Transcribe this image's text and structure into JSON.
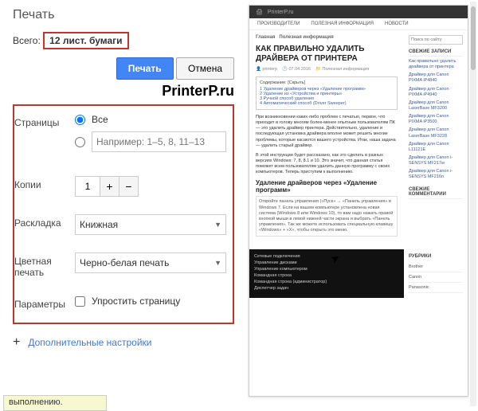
{
  "dialog": {
    "title": "Печать",
    "total_label": "Всего:",
    "total_value": "12 лист. бумаги",
    "print_button": "Печать",
    "cancel_button": "Отмена",
    "logo": "PrinterP.ru"
  },
  "form": {
    "pages_label": "Страницы",
    "pages_all": "Все",
    "pages_example_placeholder": "Например: 1–5, 8, 11–13",
    "copies_label": "Копии",
    "copies_value": "1",
    "layout_label": "Раскладка",
    "layout_value": "Книжная",
    "color_label": "Цветная\nпечать",
    "color_value": "Черно-белая печать",
    "options_label": "Параметры",
    "simplify_label": "Упростить страницу"
  },
  "more_settings": "Дополнительные настройки",
  "bottom_note": "выполнению.",
  "preview": {
    "site_name": "PrinterP.ru",
    "nav": [
      "ПРОИЗВОДИТЕЛИ",
      "ПОЛЕЗНАЯ ИНФОРМАЦИЯ",
      "НОВОСТИ"
    ],
    "breadcrumb": [
      "Главная",
      "Полезная информация"
    ],
    "h1": "КАК ПРАВИЛЬНО УДАЛИТЬ ДРАЙВЕРА ОТ ПРИНТЕРА",
    "author": "printerp",
    "date": "07.04.2016",
    "category": "Полезная информация",
    "toc_title": "Содержание: [Скрыть]",
    "toc": [
      "1 Удаление драйверов через «Удаление программ»",
      "2 Удаление из «Устройства и принтеры»",
      "3 Ручной способ удаления",
      "4 Автоматический способ (Driver Sweeper)"
    ],
    "p1": "При возникновении каких-либо проблем с печатью, первое, что приходит в голову многим более-менее опытным пользователям ПК — это удалить драйвер принтера. Действительно, удаление и последующая установка драйвера вполне может решить многие проблемы, которые касаются вашего устройства. Итак, наша задача — удалить старый драйвер.",
    "p2": "В этой инструкции будет рассказано, как это сделать в разных версиях Windows: 7, 8, 8.1 и 10. Это значит, что данная статья поможет всем пользователям удалить данную программу с своих компьютеров. Теперь приступим к выполнению.",
    "h2": "Удаление драйверов через «Удаление программ»",
    "quote": "Откройте панель управления («Пуск» → «Панель управления» в Windows 7. Если на вашем компьютере установлена новая система (Windows 8 или Windows 10), то вам надо нажать правой кнопкой мыши в левой нижней части экрана и выбрать «Панель управления». Так же можете использовать специальную клавишу «Windows» + «X», чтобы открыть это меню.",
    "search_placeholder": "Поиск по сайту",
    "side_recent_title": "СВЕЖИЕ ЗАПИСИ",
    "side_recent": [
      "Как правильно удалить драйвера от принтера",
      "Драйвер для Canon PIXMA iP4840",
      "Драйвер для Canon PIXMA iP4940",
      "Драйвер для Canon LaserBase MF3200",
      "Драйвер для Canon PIXMA iP3500",
      "Драйвер для Canon LaserBase MF3228",
      "Драйвер для Canon L11121E",
      "Драйвер для Canon i-SENSYS MF217w",
      "Драйвер для Canon i-SENSYS MF216n"
    ],
    "side_comments_title": "СВЕЖИЕ КОММЕНТАРИИ",
    "footer_links": [
      "Сетевые подключения",
      "Управление дисками",
      "Управление компьютером",
      "Командная строка",
      "Командная строка (администратор)",
      "Диспетчер задач"
    ],
    "rubrics_title": "РУБРИКИ",
    "rubrics": [
      "Brother",
      "Canon",
      "Panasonic"
    ]
  }
}
